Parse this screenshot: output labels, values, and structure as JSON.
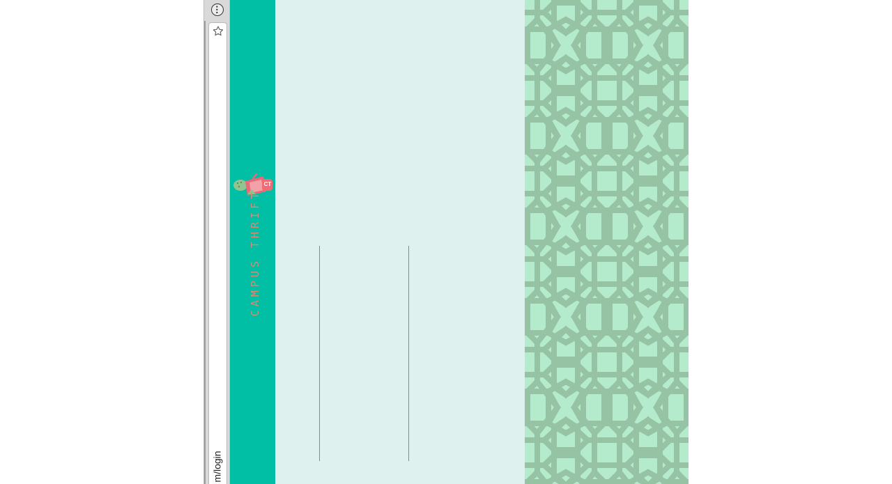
{
  "browser": {
    "menu_icon": "menu-icon",
    "star_icon": "star-icon",
    "url": "m/login"
  },
  "brand": {
    "name": "CAMPUS THRIFT",
    "logo_badge": "CT"
  },
  "colors": {
    "header_teal": "#00bfa5",
    "panel_mint": "#dff1ef",
    "pattern_light": "#b5ebcd",
    "pattern_dark": "#96c3a4",
    "brand_text": "#d98a74"
  }
}
